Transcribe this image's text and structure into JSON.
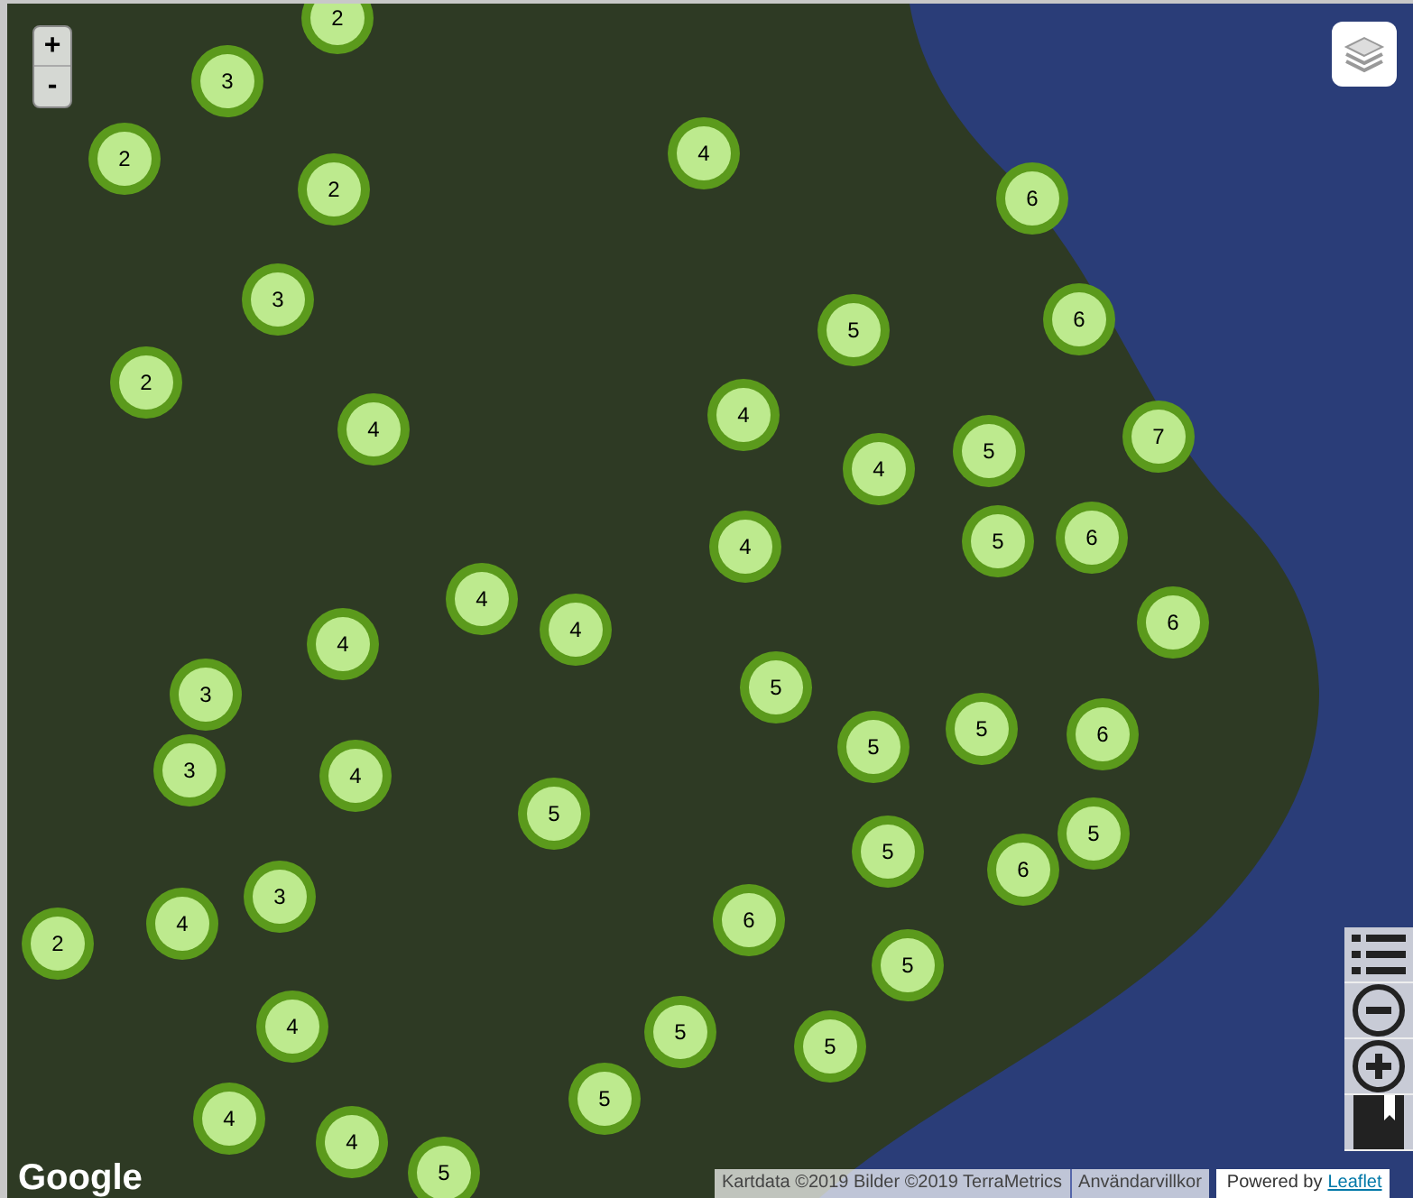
{
  "zoom_control": {
    "zoom_in": "+",
    "zoom_out": "-"
  },
  "clusters": [
    {
      "count": "2"
    },
    {
      "count": "3"
    },
    {
      "count": "2"
    },
    {
      "count": "2"
    },
    {
      "count": "4"
    },
    {
      "count": "6"
    },
    {
      "count": "3"
    },
    {
      "count": "5"
    },
    {
      "count": "6"
    },
    {
      "count": "2"
    },
    {
      "count": "4"
    },
    {
      "count": "4"
    },
    {
      "count": "4"
    },
    {
      "count": "5"
    },
    {
      "count": "7"
    },
    {
      "count": "4"
    },
    {
      "count": "5"
    },
    {
      "count": "6"
    },
    {
      "count": "4"
    },
    {
      "count": "4"
    },
    {
      "count": "4"
    },
    {
      "count": "6"
    },
    {
      "count": "3"
    },
    {
      "count": "5"
    },
    {
      "count": "3"
    },
    {
      "count": "4"
    },
    {
      "count": "5"
    },
    {
      "count": "5"
    },
    {
      "count": "6"
    },
    {
      "count": "5"
    },
    {
      "count": "5"
    },
    {
      "count": "6"
    },
    {
      "count": "5"
    },
    {
      "count": "2"
    },
    {
      "count": "4"
    },
    {
      "count": "3"
    },
    {
      "count": "6"
    },
    {
      "count": "5"
    },
    {
      "count": "4"
    },
    {
      "count": "5"
    },
    {
      "count": "5"
    },
    {
      "count": "5"
    },
    {
      "count": "4"
    },
    {
      "count": "4"
    },
    {
      "count": "5"
    }
  ],
  "logo": "Google",
  "attribution": {
    "map_data": "Kartdata ©2019 Bilder ©2019 TerraMetrics",
    "terms": "Användarvillkor",
    "powered_by": "Powered by",
    "link": "Leaflet"
  }
}
